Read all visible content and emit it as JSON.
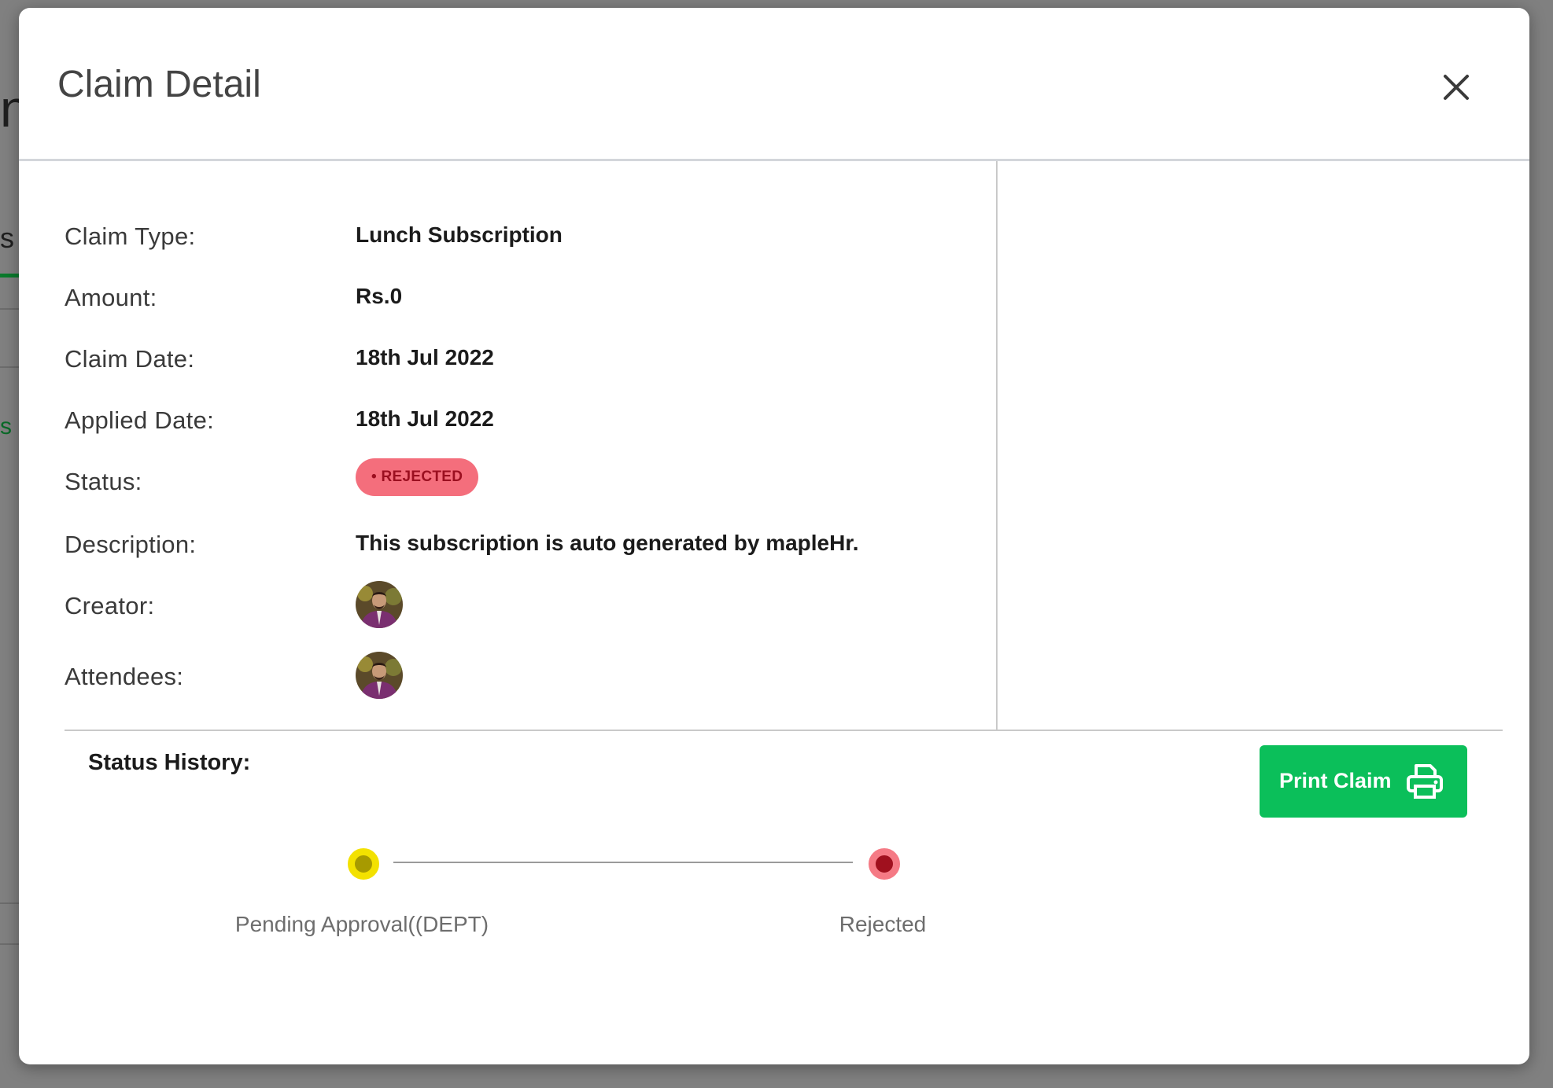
{
  "modal": {
    "title": "Claim Detail",
    "close_icon": "close-icon"
  },
  "details": [
    {
      "label": "Claim Type:",
      "value": "Lunch Subscription"
    },
    {
      "label": "Amount:",
      "value": "Rs.0"
    },
    {
      "label": "Claim Date:",
      "value": "18th Jul 2022"
    },
    {
      "label": "Applied Date:",
      "value": "18th Jul 2022"
    },
    {
      "label": "Status:",
      "value": "• REJECTED"
    },
    {
      "label": "Description:",
      "value": "This subscription is auto generated by mapleHr."
    },
    {
      "label": "Creator:",
      "value": "avatar"
    },
    {
      "label": "Attendees:",
      "value": "avatar"
    }
  ],
  "status_badge_color": "#f46e7c",
  "status_history": {
    "title": "Status History:",
    "steps": [
      {
        "label": "Pending Approval((DEPT)",
        "color": "#f3e100"
      },
      {
        "label": "Rejected",
        "color": "#f57a85"
      }
    ]
  },
  "print_button": {
    "label": "Print Claim",
    "icon": "printer-icon",
    "color": "#0bbf5a"
  },
  "background_fragments": [
    "n",
    "s",
    "s"
  ]
}
